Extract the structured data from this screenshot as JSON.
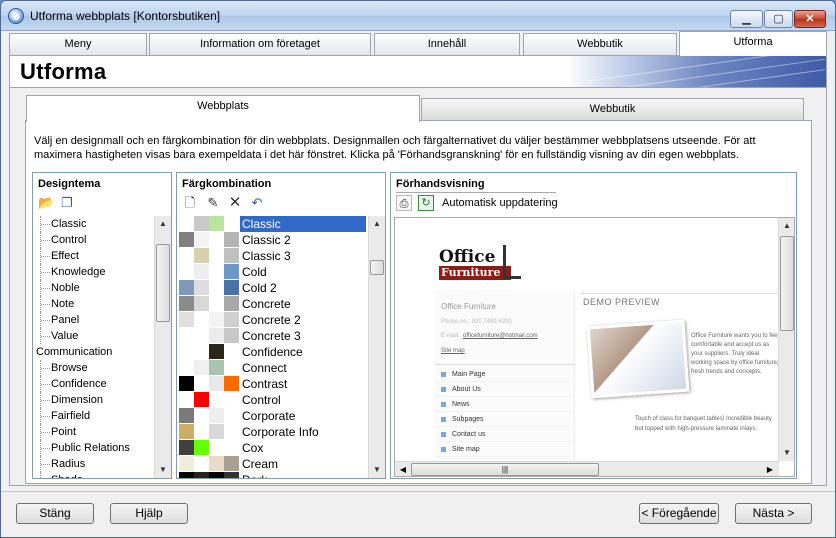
{
  "window": {
    "title": "Utforma webbplats [Kontorsbutiken]",
    "min": "▁",
    "max": "▢",
    "close": "✕"
  },
  "tabs": [
    "Meny",
    "Information om företaget",
    "Innehåll",
    "Webbutik",
    "Utforma"
  ],
  "page_title": "Utforma",
  "inner_tabs": [
    "Webbplats",
    "Webbutik"
  ],
  "intro": "Välj en designmall och en färgkombination för din webbplats. Designmallen och färgalternativet du väljer bestämmer webbplatsens utseende. För att maximera hastigheten visas bara exempeldata i det här fönstret. Klicka på 'Förhandsgranskning' för en fullständig visning av din egen webbplats.",
  "design": {
    "title": "Designtema",
    "items": [
      {
        "label": "Classic",
        "child": true
      },
      {
        "label": "Control",
        "child": true
      },
      {
        "label": "Effect",
        "child": true
      },
      {
        "label": "Knowledge",
        "child": true
      },
      {
        "label": "Noble",
        "child": true
      },
      {
        "label": "Note",
        "child": true
      },
      {
        "label": "Panel",
        "child": true
      },
      {
        "label": "Value",
        "child": true
      },
      {
        "label": "Communication",
        "child": false
      },
      {
        "label": "Browse",
        "child": true
      },
      {
        "label": "Confidence",
        "child": true
      },
      {
        "label": "Dimension",
        "child": true
      },
      {
        "label": "Fairfield",
        "child": true
      },
      {
        "label": "Point",
        "child": true
      },
      {
        "label": "Public Relations",
        "child": true
      },
      {
        "label": "Radius",
        "child": true
      },
      {
        "label": "Shade",
        "child": true
      }
    ]
  },
  "colors": {
    "title": "Färgkombination",
    "selected": "Classic",
    "items": [
      {
        "label": "Classic",
        "sw": [
          "#ffffff",
          "#c9c9c9",
          "#b8e6a0",
          "#ffffff"
        ]
      },
      {
        "label": "Classic 2",
        "sw": [
          "#808080",
          "#f4f4f4",
          "#ffffff",
          "#b4b4b4"
        ]
      },
      {
        "label": "Classic 3",
        "sw": [
          "#ffffff",
          "#d8d0a8",
          "#ffffff",
          "#c0c0c0"
        ]
      },
      {
        "label": "Cold",
        "sw": [
          "#ffffff",
          "#eeeeee",
          "#ffffff",
          "#6b98c8"
        ]
      },
      {
        "label": "Cold 2",
        "sw": [
          "#7f99bb",
          "#dddddd",
          "#ffffff",
          "#4a72a8"
        ]
      },
      {
        "label": "Concrete",
        "sw": [
          "#8a8a8a",
          "#d8d8d8",
          "#ffffff",
          "#a8a8a8"
        ]
      },
      {
        "label": "Concrete 2",
        "sw": [
          "#e0e0e0",
          "#ffffff",
          "#f4f4f4",
          "#d0d0d0"
        ]
      },
      {
        "label": "Concrete 3",
        "sw": [
          "#ffffff",
          "#ffffff",
          "#ececec",
          "#c8c8c8"
        ]
      },
      {
        "label": "Confidence",
        "sw": [
          "#ffffff",
          "#ffffff",
          "#2a261a",
          "#ffffff"
        ]
      },
      {
        "label": "Connect",
        "sw": [
          "#ffffff",
          "#f0f0f0",
          "#a8c4b0",
          "#ffffff"
        ]
      },
      {
        "label": "Contrast",
        "sw": [
          "#000000",
          "#ffffff",
          "#e8e8e8",
          "#ff6a00"
        ]
      },
      {
        "label": "Control",
        "sw": [
          "#ffffff",
          "#ff0000",
          "#ffffff",
          "#ffffff"
        ]
      },
      {
        "label": "Corporate",
        "sw": [
          "#7a7a7a",
          "#ffffff",
          "#eeeeee",
          "#ffffff"
        ]
      },
      {
        "label": "Corporate Info",
        "sw": [
          "#c8b060",
          "#ffffff",
          "#d8d8d8",
          "#ffffff"
        ]
      },
      {
        "label": "Cox",
        "sw": [
          "#404040",
          "#66ff00",
          "#ffffff",
          "#ffffff"
        ]
      },
      {
        "label": "Cream",
        "sw": [
          "#f0ece0",
          "#ffffff",
          "#e8dcc8",
          "#a8a090"
        ]
      },
      {
        "label": "Dark",
        "sw": [
          "#000000",
          "#222222",
          "#000000",
          "#333333"
        ]
      }
    ]
  },
  "preview": {
    "title": "Förhandsvisning",
    "auto_update": "Automatisk uppdatering",
    "logo_line1": "Office",
    "logo_line2": "Furniture",
    "company": "Office Furniture",
    "phone": "Phone no.: 020 7489 6200",
    "email_label": "E-mail:",
    "email": "officefurniture@hotmail.com",
    "sitemap": "Site map",
    "demo": "DEMO PREVIEW",
    "nav": [
      "Main Page",
      "About Us",
      "News",
      "Subpages",
      "Contact us",
      "Site map"
    ],
    "body1": "Office Furniture wants you to feel comfortable and accept us as your suppliers. Truly ideal working space by office furniture, fresh trends and concepts, personal service and any budget, we make your dream office a reality.",
    "body2": "Touch of class for banquet tables! Incredible beauty but topped with high-pressure laminate inlays."
  },
  "buttons": {
    "close": "Stäng",
    "help": "Hjälp",
    "prev": "< Föregående",
    "next": "Nästa >"
  }
}
